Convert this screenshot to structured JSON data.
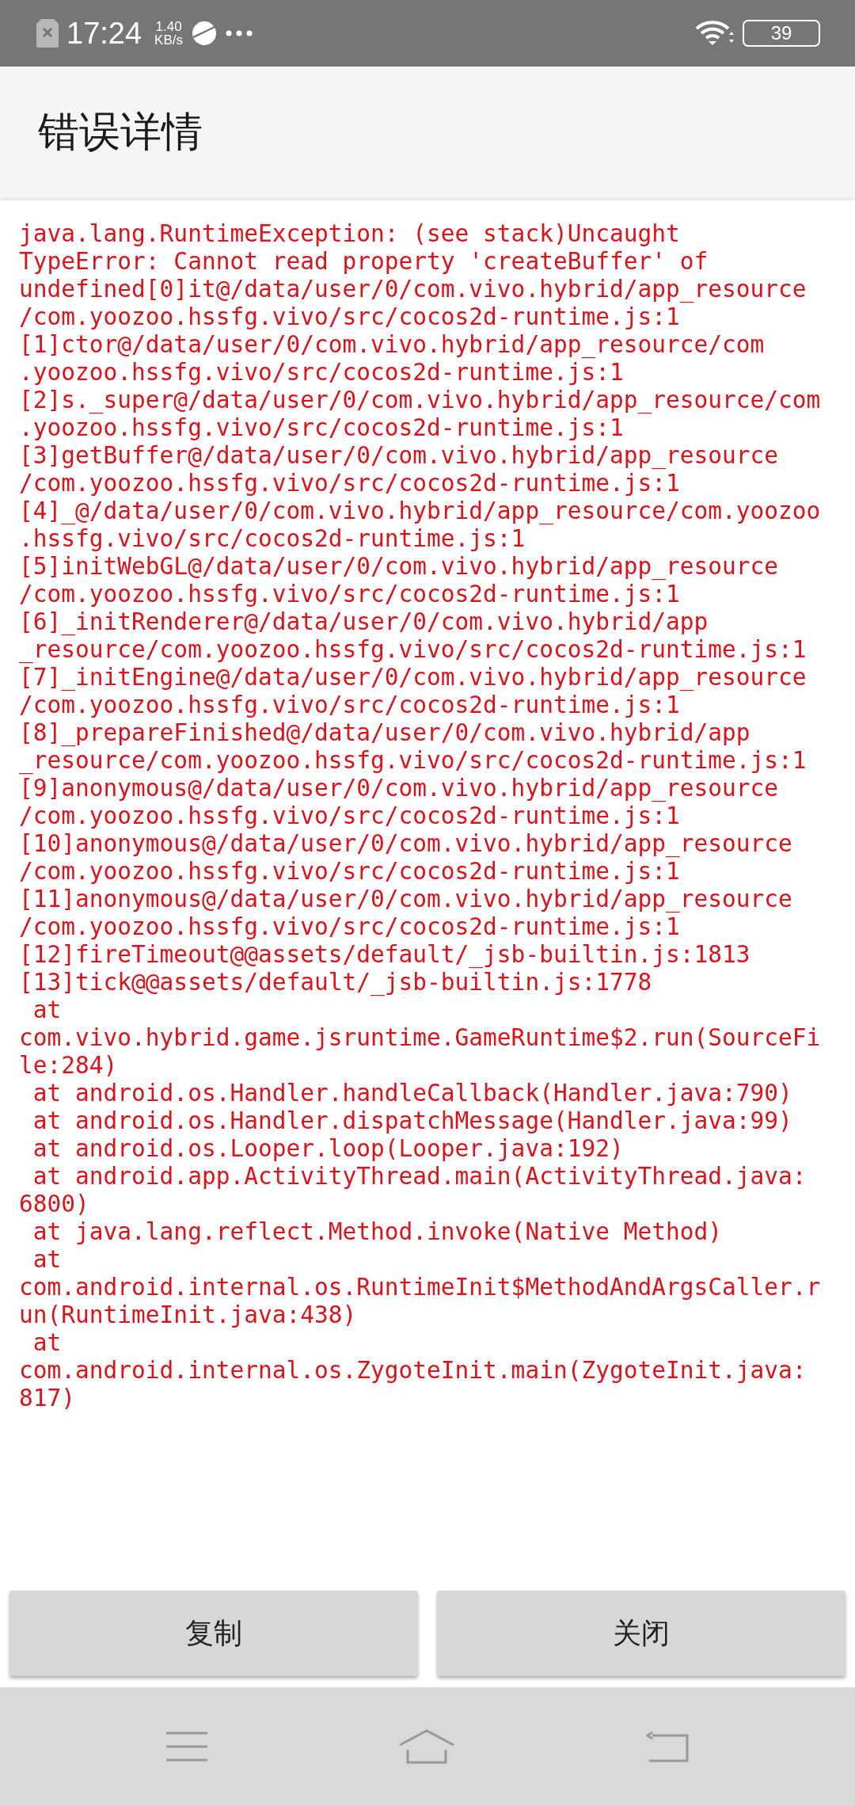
{
  "status_bar": {
    "time": "17:24",
    "speed_value": "1.40",
    "speed_unit": "KB/s",
    "battery": "39"
  },
  "header": {
    "title": "错误详情"
  },
  "error_lines": [
    "java.lang.RuntimeException: (see stack)Uncaught",
    "TypeError: Cannot read property 'createBuffer' of",
    "undefined[0]it@/data/user/0/com.vivo.hybrid/app_resource",
    "/com.yoozoo.hssfg.vivo/src/cocos2d-runtime.js:1",
    "[1]ctor@/data/user/0/com.vivo.hybrid/app_resource/com",
    ".yoozoo.hssfg.vivo/src/cocos2d-runtime.js:1",
    "[2]s._super@/data/user/0/com.vivo.hybrid/app_resource/com",
    ".yoozoo.hssfg.vivo/src/cocos2d-runtime.js:1",
    "[3]getBuffer@/data/user/0/com.vivo.hybrid/app_resource",
    "/com.yoozoo.hssfg.vivo/src/cocos2d-runtime.js:1",
    "[4]_@/data/user/0/com.vivo.hybrid/app_resource/com.yoozoo",
    ".hssfg.vivo/src/cocos2d-runtime.js:1",
    "[5]initWebGL@/data/user/0/com.vivo.hybrid/app_resource",
    "/com.yoozoo.hssfg.vivo/src/cocos2d-runtime.js:1",
    "[6]_initRenderer@/data/user/0/com.vivo.hybrid/app",
    "_resource/com.yoozoo.hssfg.vivo/src/cocos2d-runtime.js:1",
    "[7]_initEngine@/data/user/0/com.vivo.hybrid/app_resource",
    "/com.yoozoo.hssfg.vivo/src/cocos2d-runtime.js:1",
    "[8]_prepareFinished@/data/user/0/com.vivo.hybrid/app",
    "_resource/com.yoozoo.hssfg.vivo/src/cocos2d-runtime.js:1",
    "[9]anonymous@/data/user/0/com.vivo.hybrid/app_resource",
    "/com.yoozoo.hssfg.vivo/src/cocos2d-runtime.js:1",
    "[10]anonymous@/data/user/0/com.vivo.hybrid/app_resource",
    "/com.yoozoo.hssfg.vivo/src/cocos2d-runtime.js:1",
    "[11]anonymous@/data/user/0/com.vivo.hybrid/app_resource",
    "/com.yoozoo.hssfg.vivo/src/cocos2d-runtime.js:1",
    "[12]fireTimeout@@assets/default/_jsb-builtin.js:1813",
    "[13]tick@@assets/default/_jsb-builtin.js:1778",
    " at",
    "com.vivo.hybrid.game.jsruntime.GameRuntime$2.run(SourceFi",
    "le:284)",
    " at android.os.Handler.handleCallback(Handler.java:790)",
    " at android.os.Handler.dispatchMessage(Handler.java:99)",
    " at android.os.Looper.loop(Looper.java:192)",
    " at android.app.ActivityThread.main(ActivityThread.java:",
    "6800)",
    " at java.lang.reflect.Method.invoke(Native Method)",
    " at",
    "com.android.internal.os.RuntimeInit$MethodAndArgsCaller.r",
    "un(RuntimeInit.java:438)",
    " at",
    "com.android.internal.os.ZygoteInit.main(ZygoteInit.java:",
    "817)"
  ],
  "buttons": [
    {
      "label": "复制"
    },
    {
      "label": "关闭"
    }
  ]
}
